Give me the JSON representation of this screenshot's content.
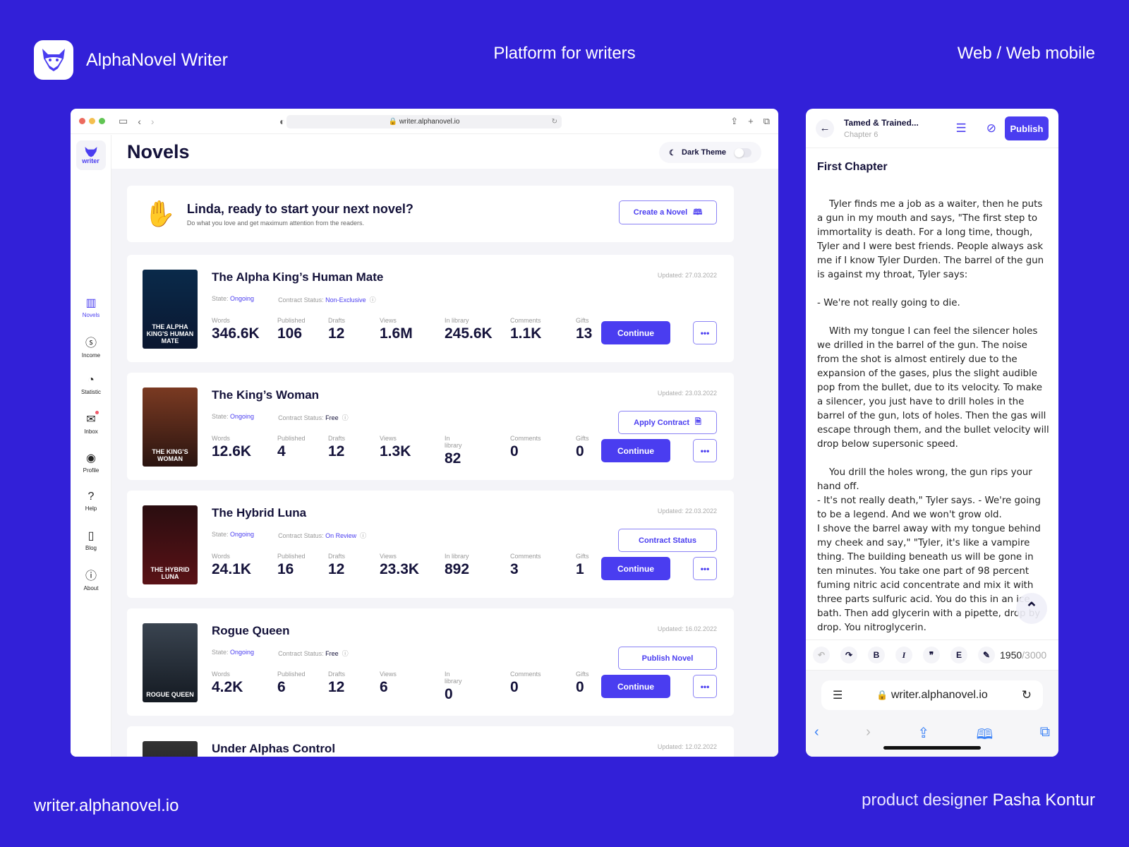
{
  "brand": {
    "name": "AlphaNovel Writer",
    "tagline": "Platform for writers",
    "platforms": "Web / Web mobile",
    "site": "writer.alphanovel.io",
    "credit_prefix": "product designer",
    "credit_name": "Pasha Kontur"
  },
  "browser": {
    "url": "writer.alphanovel.io"
  },
  "sidebar": {
    "logo_label": "writer",
    "items": [
      {
        "label": "Novels",
        "icon": "books-icon",
        "glyph": "▥"
      },
      {
        "label": "Income",
        "icon": "dollar-icon",
        "glyph": "ⓢ"
      },
      {
        "label": "Statistic",
        "icon": "chart-icon",
        "glyph": "◔"
      },
      {
        "label": "Inbox",
        "icon": "mail-icon",
        "glyph": "✉"
      },
      {
        "label": "Profile",
        "icon": "profile-icon",
        "glyph": "◉"
      },
      {
        "label": "Help",
        "icon": "help-icon",
        "glyph": "?"
      },
      {
        "label": "Blog",
        "icon": "blog-icon",
        "glyph": "▯"
      },
      {
        "label": "About",
        "icon": "info-icon",
        "glyph": "ⓘ"
      }
    ]
  },
  "header": {
    "title": "Novels",
    "theme_label": "Dark Theme",
    "dark_theme_on": false
  },
  "welcome": {
    "title": "Linda, ready to start your next novel?",
    "subtitle": "Do what you love and get maximum attention from the readers.",
    "create_label": "Create a Novel"
  },
  "stat_labels": [
    "Words",
    "Published",
    "Drafts",
    "Views",
    "In library",
    "Comments",
    "Gifts"
  ],
  "novels": [
    {
      "title": "The Alpha King’s Human Mate",
      "state_label": "State:",
      "state": "Ongoing",
      "contract_label": "Contract Status:",
      "contract": "Non-Exclusive",
      "updated": "Updated: 27.03.2022",
      "stats": [
        "346.6K",
        "106",
        "12",
        "1.6M",
        "245.6K",
        "1.1K",
        "13"
      ],
      "secondary": "",
      "continue": "Continue",
      "cover_text": "THE ALPHA KING'S HUMAN MATE"
    },
    {
      "title": "The King’s Woman",
      "state_label": "State:",
      "state": "Ongoing",
      "contract_label": "Contract Status:",
      "contract": "Free",
      "updated": "Updated: 23.03.2022",
      "stats": [
        "12.6K",
        "4",
        "12",
        "1.3K",
        "82",
        "0",
        "0"
      ],
      "secondary": "Apply Contract",
      "continue": "Continue",
      "cover_text": "THE KING'S WOMAN"
    },
    {
      "title": "The Hybrid Luna",
      "state_label": "State:",
      "state": "Ongoing",
      "contract_label": "Contract Status:",
      "contract": "On Review",
      "updated": "Updated: 22.03.2022",
      "stats": [
        "24.1K",
        "16",
        "12",
        "23.3K",
        "892",
        "3",
        "1"
      ],
      "secondary": "Contract Status",
      "continue": "Continue",
      "cover_text": "THE HYBRID LUNA"
    },
    {
      "title": "Rogue Queen",
      "state_label": "State:",
      "state": "Ongoing",
      "contract_label": "Contract Status:",
      "contract": "Free",
      "updated": "Updated: 16.02.2022",
      "stats": [
        "4.2K",
        "6",
        "12",
        "6",
        "0",
        "0",
        "0"
      ],
      "secondary": "Publish Novel",
      "continue": "Continue",
      "cover_text": "ROGUE QUEEN"
    },
    {
      "title": "Under Alphas Control",
      "updated": "Updated: 12.02.2022"
    }
  ],
  "mobile": {
    "book_title": "Tamed & Trained...",
    "chapter_sub": "Chapter 6",
    "publish": "Publish",
    "chapter_title": "First Chapter",
    "text": "    Tyler finds me a job as a waiter, then he puts a gun in my mouth and says, \"The first step to immortality is death. For a long time, though, Tyler and I were best friends. People always ask me if I know Tyler Durden. The barrel of the gun is against my throat, Tyler says:\n\n- We're not really going to die.\n\n    With my tongue I can feel the silencer holes we drilled in the barrel of the gun. The noise from the shot is almost entirely due to the expansion of the gases, plus the slight audible pop from the bullet, due to its velocity. To make a silencer, you just have to drill holes in the barrel of the gun, lots of holes. Then the gas will escape through them, and the bullet velocity will drop below supersonic speed.\n\n    You drill the holes wrong, the gun rips your hand off.\n- It's not really death,\" Tyler says. - We're going to be a legend. And we won't grow old.\nI shove the barrel away with my tongue behind my cheek and say,\" \"Tyler, it's like a vampire thing. The building beneath us will be gone in ten minutes. You take one part of 98 percent fuming nitric acid concentrate and mix it with three parts sulfuric acid. You do this in an ice bath. Then add glycerin with a pipette, drop by drop. You nitroglycerin.",
    "words_count": "1950",
    "words_limit": "/3000",
    "safari_url": "writer.alphanovel.io"
  }
}
